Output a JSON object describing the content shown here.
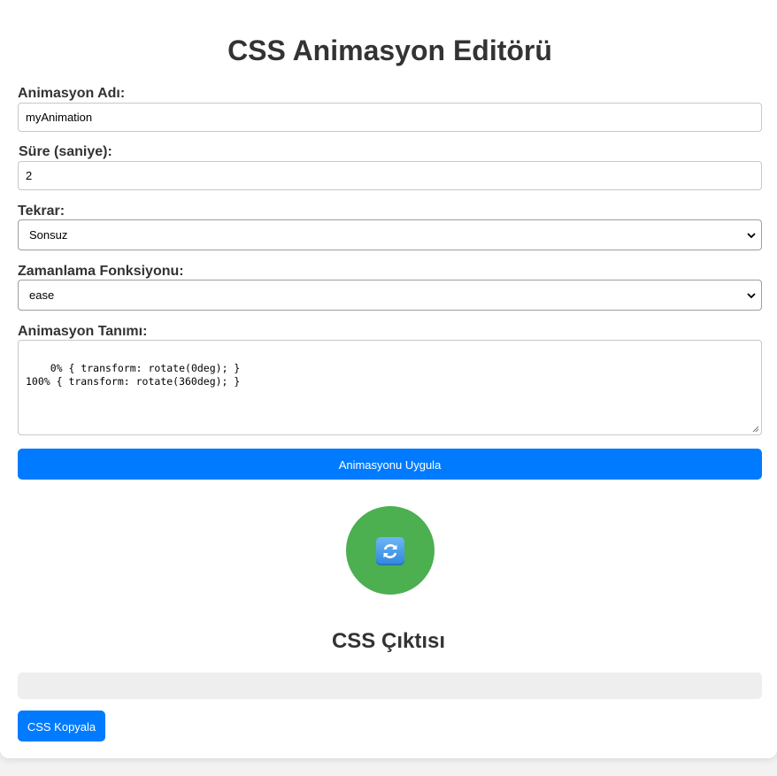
{
  "page": {
    "title": "CSS Animasyon Editörü"
  },
  "form": {
    "name_label": "Animasyon Adı:",
    "name_value": "myAnimation",
    "duration_label": "Süre (saniye):",
    "duration_value": "2",
    "repeat_label": "Tekrar:",
    "repeat_selected": "Sonsuz",
    "timing_label": "Zamanlama Fonksiyonu:",
    "timing_selected": "ease",
    "definition_label": "Animasyon Tanımı:",
    "definition_value": "0% { transform: rotate(0deg); }\n100% { transform: rotate(360deg); }",
    "apply_label": "Animasyonu Uygula"
  },
  "preview": {
    "icon": "refresh-icon",
    "circle_color": "#4caf50"
  },
  "output": {
    "heading": "CSS Çıktısı",
    "css_text": "",
    "copy_label": "CSS Kopyala"
  },
  "colors": {
    "accent": "#007bff",
    "text": "#333333"
  }
}
